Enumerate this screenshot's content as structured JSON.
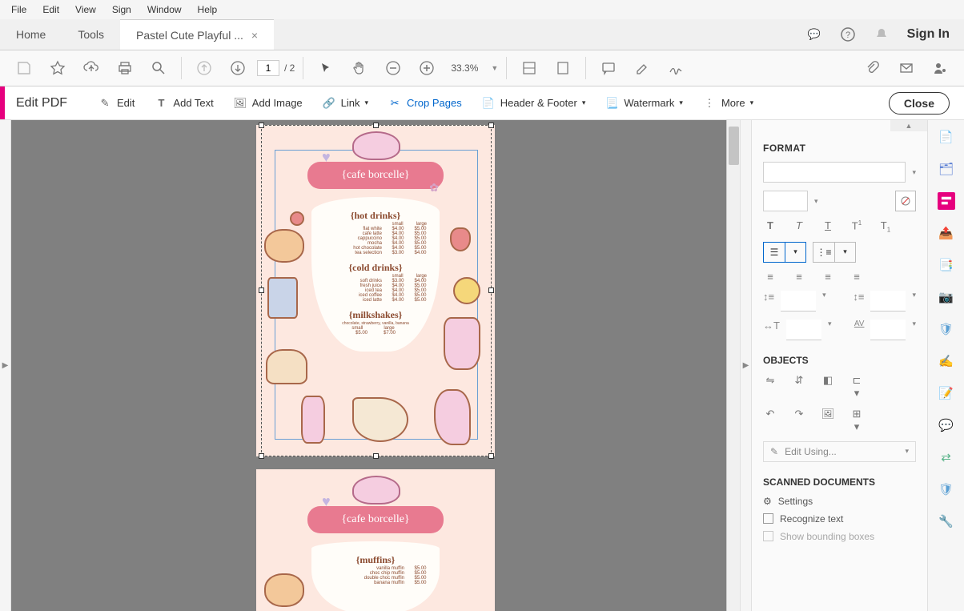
{
  "menubar": [
    "File",
    "Edit",
    "View",
    "Sign",
    "Window",
    "Help"
  ],
  "tabs": {
    "home": "Home",
    "tools": "Tools",
    "doc": "Pastel Cute Playful ..."
  },
  "signin": "Sign In",
  "toolbar": {
    "page_current": "1",
    "page_total": "/  2",
    "zoom": "33.3%"
  },
  "editbar": {
    "title": "Edit PDF",
    "edit": "Edit",
    "add_text": "Add Text",
    "add_image": "Add Image",
    "link": "Link",
    "crop": "Crop Pages",
    "header": "Header & Footer",
    "watermark": "Watermark",
    "more": "More",
    "close": "Close"
  },
  "menu": {
    "cafe_title": "{cafe borcelle}",
    "sections": {
      "hot": {
        "title": "{hot drinks}",
        "cols": [
          "small",
          "large"
        ],
        "items": [
          {
            "n": "flat white",
            "s": "$4.00",
            "l": "$5.00"
          },
          {
            "n": "cafe latte",
            "s": "$4.00",
            "l": "$5.00"
          },
          {
            "n": "cappuccino",
            "s": "$4.00",
            "l": "$5.00"
          },
          {
            "n": "mocha",
            "s": "$4.00",
            "l": "$5.00"
          },
          {
            "n": "hot chocolate",
            "s": "$4.00",
            "l": "$5.00"
          },
          {
            "n": "tea selection",
            "s": "$3.00",
            "l": "$4.00"
          }
        ]
      },
      "cold": {
        "title": "{cold drinks}",
        "cols": [
          "small",
          "large"
        ],
        "items": [
          {
            "n": "soft drinks",
            "s": "$3.00",
            "l": "$4.00"
          },
          {
            "n": "fresh juice",
            "s": "$4.00",
            "l": "$5.00"
          },
          {
            "n": "iced tea",
            "s": "$4.00",
            "l": "$5.00"
          },
          {
            "n": "iced coffee",
            "s": "$4.00",
            "l": "$5.00"
          },
          {
            "n": "iced latte",
            "s": "$4.00",
            "l": "$5.00"
          }
        ]
      },
      "milk": {
        "title": "{milkshakes}",
        "flavors": "chocolate, strawberry, vanilla, banana",
        "cols": [
          "small",
          "large"
        ],
        "s": "$5.00",
        "l": "$7.00"
      },
      "muffins": {
        "title": "{muffins}",
        "items": [
          {
            "n": "vanilla muffin",
            "p": "$5.00"
          },
          {
            "n": "choc chip muffin",
            "p": "$5.00"
          },
          {
            "n": "double choc muffin",
            "p": "$5.00"
          },
          {
            "n": "banana muffin",
            "p": "$5.00"
          }
        ]
      }
    }
  },
  "format": {
    "h1": "FORMAT",
    "h2": "OBJECTS",
    "h3": "SCANNED DOCUMENTS",
    "edit_using": "Edit Using...",
    "settings": "Settings",
    "recognize": "Recognize text",
    "bounding": "Show bounding boxes"
  }
}
